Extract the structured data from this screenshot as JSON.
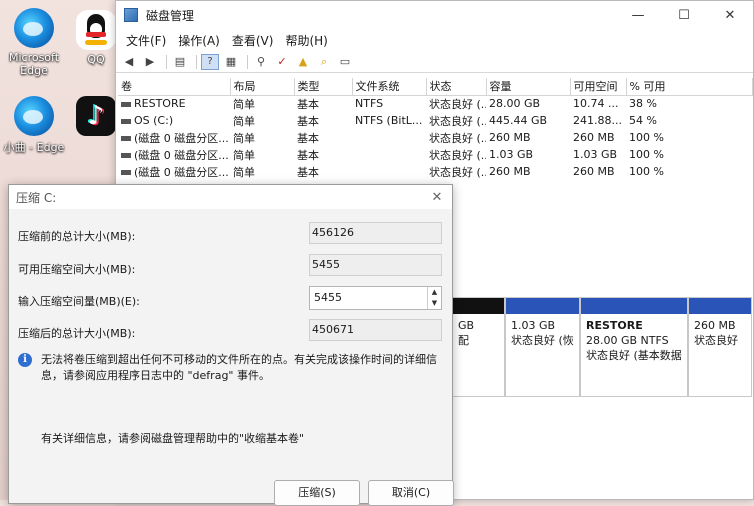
{
  "desktop": {
    "icons": [
      {
        "label": "Microsoft\nEdge"
      },
      {
        "label": "QQ"
      },
      {
        "label": "小曲 - Edge"
      }
    ]
  },
  "window": {
    "title": "磁盘管理",
    "controls": {
      "minimize": "—",
      "maximize": "☐",
      "close": "✕"
    },
    "menu": [
      "文件(F)",
      "操作(A)",
      "查看(V)",
      "帮助(H)"
    ]
  },
  "volumes": {
    "headers": [
      "卷",
      "布局",
      "类型",
      "文件系统",
      "状态",
      "容量",
      "可用空间",
      "% 可用"
    ],
    "rows": [
      [
        "RESTORE",
        "简单",
        "基本",
        "NTFS",
        "状态良好 (...",
        "28.00 GB",
        "10.74 ...",
        "38 %"
      ],
      [
        "OS (C:)",
        "简单",
        "基本",
        "NTFS (BitL...",
        "状态良好 (...",
        "445.44 GB",
        "241.88...",
        "54 %"
      ],
      [
        "(磁盘 0 磁盘分区...",
        "简单",
        "基本",
        "",
        "状态良好 (...",
        "260 MB",
        "260 MB",
        "100 %"
      ],
      [
        "(磁盘 0 磁盘分区...",
        "简单",
        "基本",
        "",
        "状态良好 (...",
        "1.03 GB",
        "1.03 GB",
        "100 %"
      ],
      [
        "(磁盘 0 磁盘分区...",
        "简单",
        "基本",
        "",
        "状态良好 (...",
        "260 MB",
        "260 MB",
        "100 %"
      ]
    ]
  },
  "diskmap": {
    "segments": [
      {
        "l1": "GB",
        "l2": "配"
      },
      {
        "l1": "1.03 GB",
        "l2": "状态良好 (恢"
      },
      {
        "title": "RESTORE",
        "l1": "28.00 GB NTFS",
        "l2": "状态良好 (基本数据"
      },
      {
        "l1": "260 MB",
        "l2": "状态良好"
      }
    ]
  },
  "dialog": {
    "title": "压缩 C:",
    "total_before_label": "压缩前的总计大小(MB):",
    "total_before_value": "456126",
    "available_label": "可用压缩空间大小(MB):",
    "available_value": "5455",
    "input_label": "输入压缩空间量(MB)(E):",
    "input_value": "5455",
    "total_after_label": "压缩后的总计大小(MB):",
    "total_after_value": "450671",
    "info_text": "无法将卷压缩到超出任何不可移动的文件所在的点。有关完成该操作时间的详细信息，请参阅应用程序日志中的 \"defrag\" 事件。",
    "help_text": "有关详细信息，请参阅磁盘管理帮助中的\"收缩基本卷\"",
    "shrink_button": "压缩(S)",
    "cancel_button": "取消(C)"
  }
}
